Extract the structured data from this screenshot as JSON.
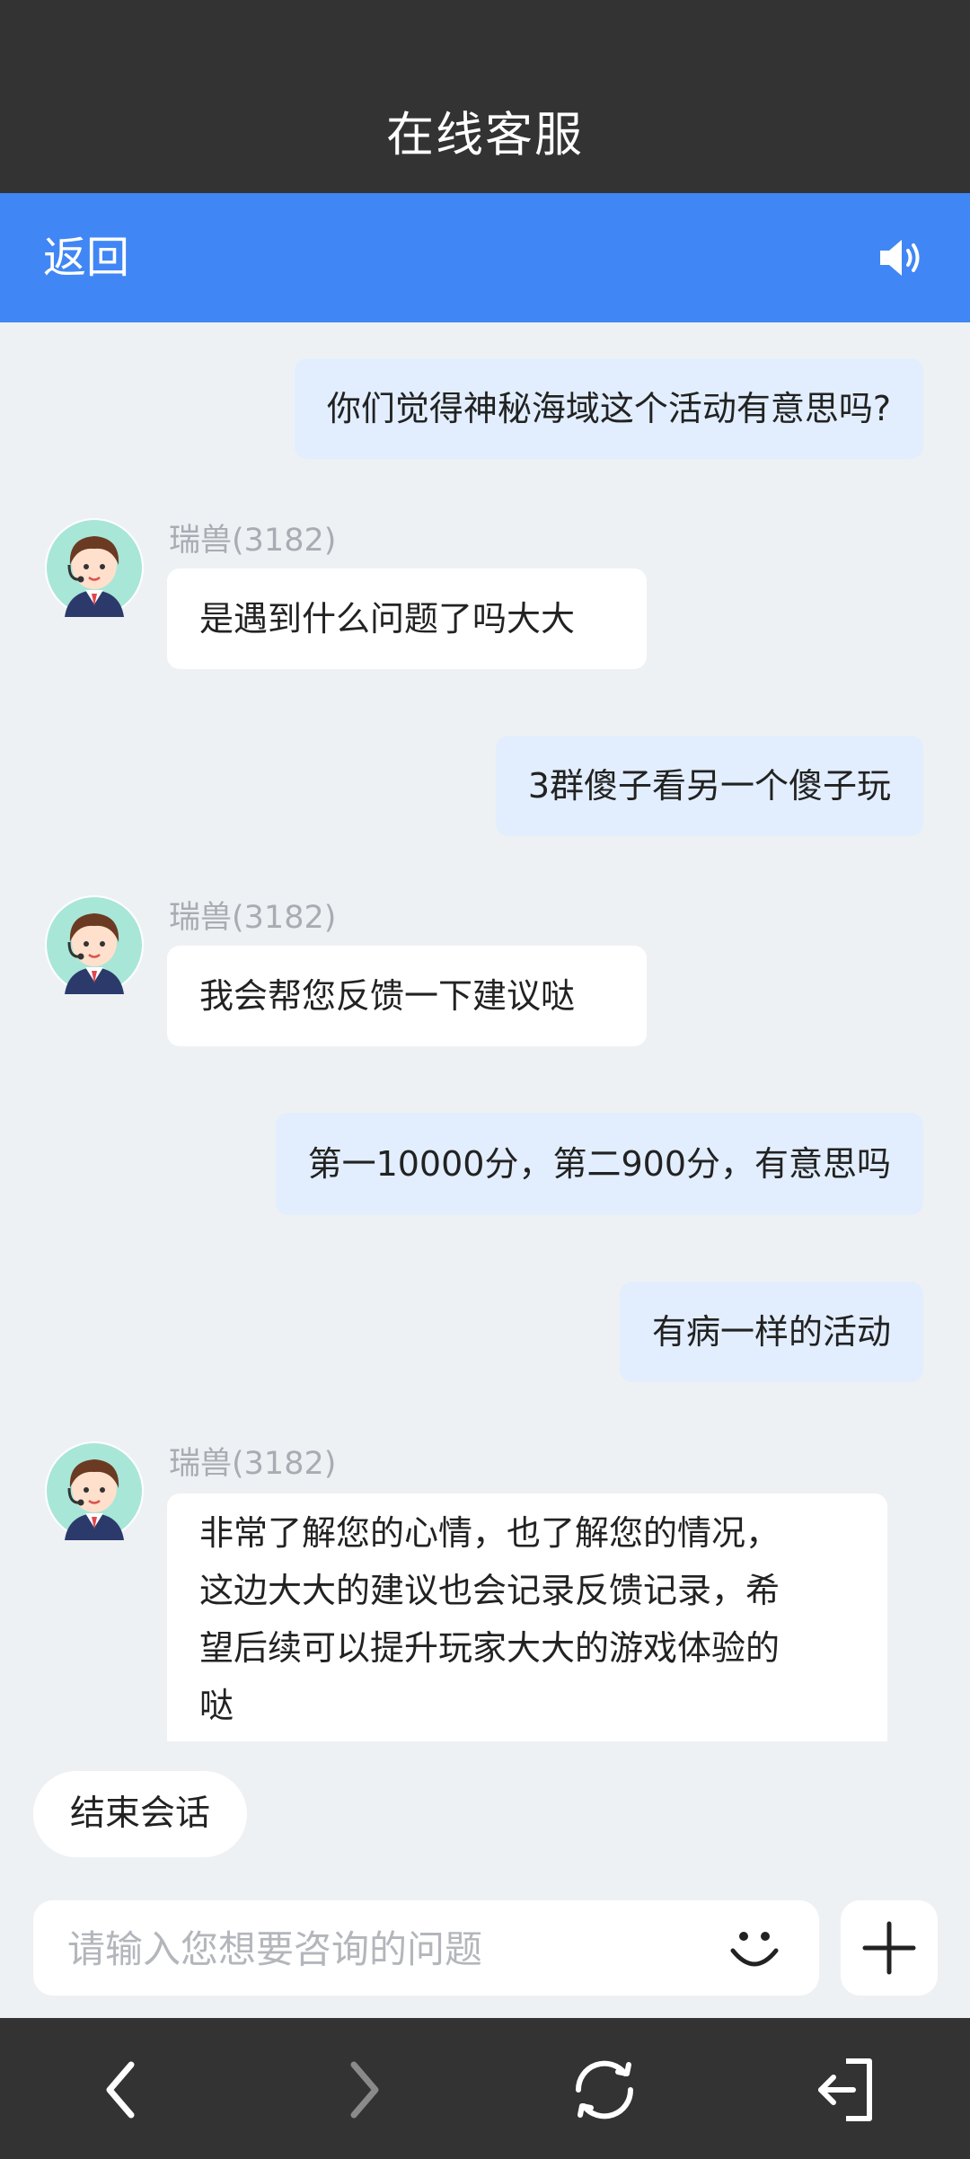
{
  "titlebar": {
    "title": "在线客服"
  },
  "navbar": {
    "back_label": "返回",
    "sound_icon": "speaker-icon"
  },
  "messages": [
    {
      "from": "user",
      "text": "你们觉得神秘海域这个活动有意思吗?"
    },
    {
      "from": "agent",
      "name": "瑞兽(3182)",
      "text": "是遇到什么问题了吗大大"
    },
    {
      "from": "user",
      "text": "3群傻子看另一个傻子玩"
    },
    {
      "from": "agent",
      "name": "瑞兽(3182)",
      "text": "我会帮您反馈一下建议哒"
    },
    {
      "from": "user",
      "text": "第一10000分，第二900分，有意思吗"
    },
    {
      "from": "user",
      "text": "有病一样的活动"
    },
    {
      "from": "agent",
      "name": "瑞兽(3182)",
      "lines": [
        "非常了解您的心情，也了解您的情况，",
        "这边大大的建议也会记录反馈记录，希",
        "望后续可以提升玩家大大的游戏体验的",
        "哒"
      ]
    }
  ],
  "end_session_label": "结束会话",
  "input": {
    "placeholder": "请输入您想要咨询的问题",
    "value": ""
  },
  "colors": {
    "accent": "#4086f5",
    "bar": "#333333",
    "user_bubble": "#e2eefd"
  }
}
